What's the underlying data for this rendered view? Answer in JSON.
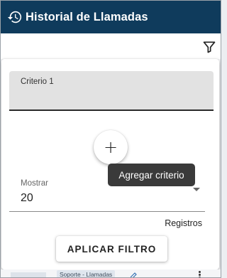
{
  "header": {
    "title": "Historial de Llamadas",
    "icon": "history-icon",
    "background": "#0f3b5c"
  },
  "toolbar": {
    "filter_icon": "filter-icon"
  },
  "filter_panel": {
    "criterio_label": "Criterio 1",
    "add_button_symbol": "+",
    "add_tooltip": "Agregar criterio",
    "mostrar_label": "Mostrar",
    "mostrar_value": "20",
    "registros_label": "Registros",
    "apply_button_label": "APLICAR FILTRO"
  },
  "list_peek": {
    "tag_text": "Soporte - Llamadas"
  }
}
